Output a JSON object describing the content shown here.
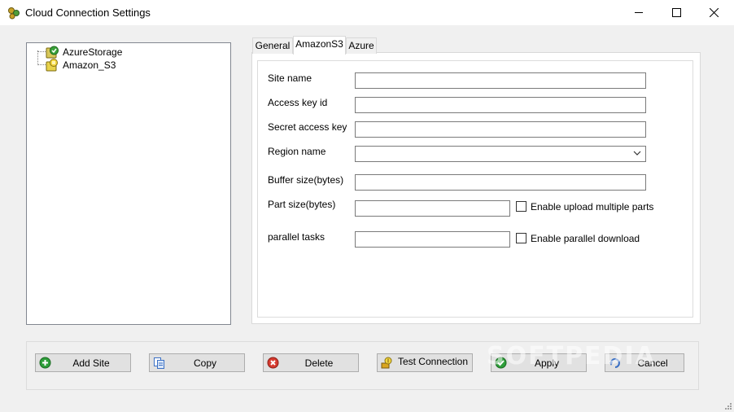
{
  "window": {
    "title": "Cloud Connection Settings",
    "icon": "cloud-connections-icon",
    "controls": [
      "minimize-icon",
      "maximize-icon",
      "close-icon"
    ]
  },
  "tree": {
    "items": [
      {
        "label": "AzureStorage",
        "icon": "azure-storage-icon"
      },
      {
        "label": "Amazon_S3",
        "icon": "amazon-s3-icon"
      }
    ]
  },
  "tabs": [
    {
      "label": "General",
      "active": false
    },
    {
      "label": "AmazonS3",
      "active": true
    },
    {
      "label": "Azure",
      "active": false
    }
  ],
  "form": {
    "site_name": {
      "label": "Site name",
      "value": ""
    },
    "access_key_id": {
      "label": "Access key id",
      "value": ""
    },
    "secret_access_key": {
      "label": "Secret access key",
      "value": ""
    },
    "region_name": {
      "label": "Region name",
      "value": ""
    },
    "buffer_size": {
      "label": "Buffer size(bytes)",
      "value": ""
    },
    "part_size": {
      "label": "Part size(bytes)",
      "value": ""
    },
    "parallel_tasks": {
      "label": "parallel tasks",
      "value": ""
    },
    "enable_upload_multiple_parts": {
      "label": "Enable upload multiple parts",
      "checked": false
    },
    "enable_parallel_download": {
      "label": "Enable parallel download",
      "checked": false
    }
  },
  "buttons": {
    "add_site": {
      "label": "Add Site",
      "icon": "add-icon",
      "color": "#2e9e3a"
    },
    "copy": {
      "label": "Copy",
      "icon": "copy-icon",
      "color": "#3a6fc4"
    },
    "delete": {
      "label": "Delete",
      "icon": "delete-icon",
      "color": "#d63a2f"
    },
    "test_connection": {
      "label": "Test Connection",
      "icon": "test-connection-icon",
      "color": "#d9a520"
    },
    "apply": {
      "label": "Apply",
      "icon": "apply-icon",
      "color": "#2e9e3a"
    },
    "cancel": {
      "label": "Cancel",
      "icon": "cancel-icon",
      "color": "#3a6fc4"
    }
  },
  "watermark": "SOFTPEDIA"
}
